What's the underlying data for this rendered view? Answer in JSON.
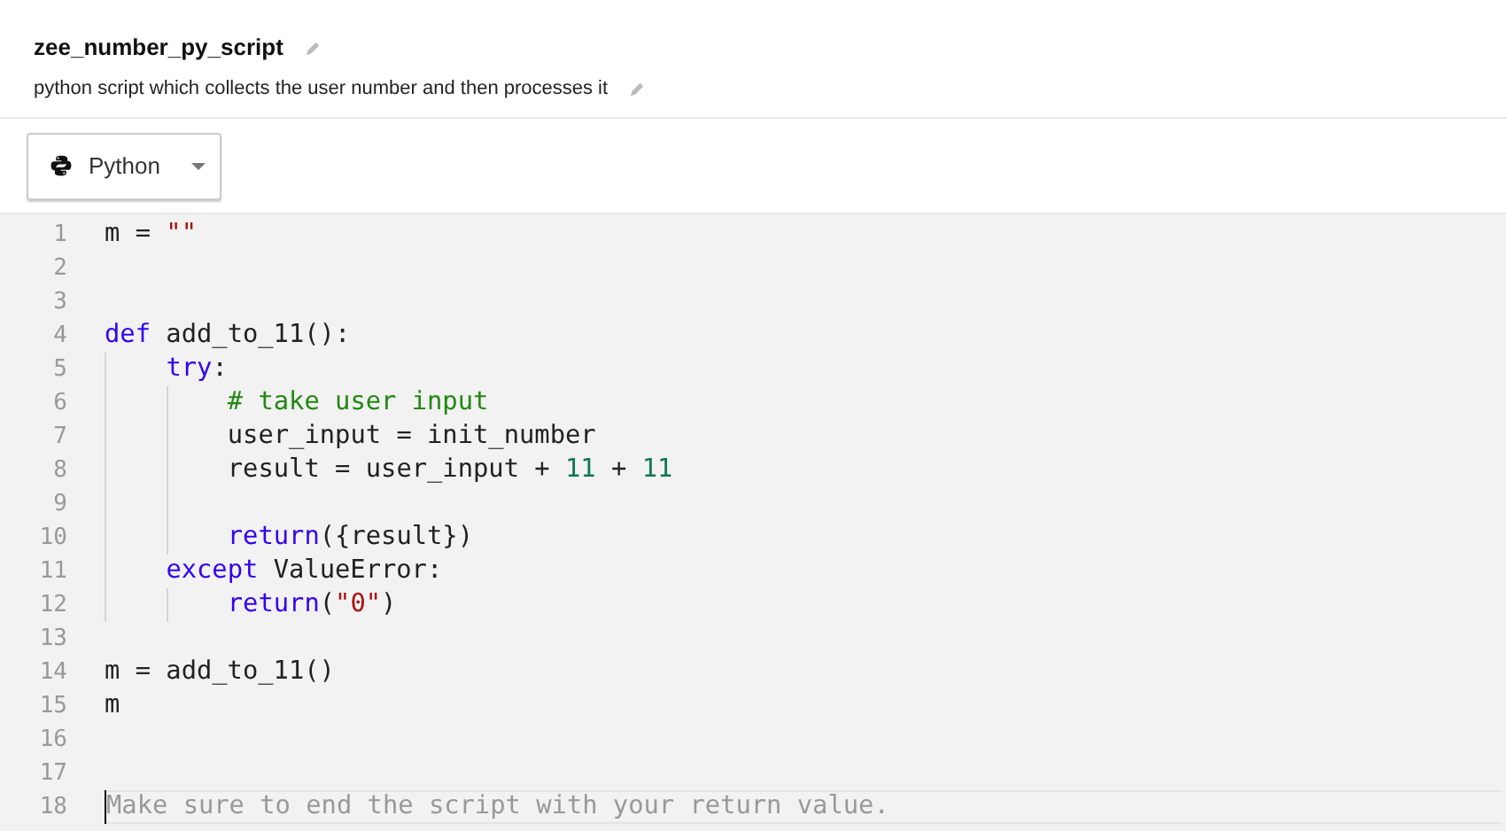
{
  "title": "zee_number_py_script",
  "description": "python script which collects the user number and then processes it",
  "language": {
    "label": "Python"
  },
  "editor": {
    "lines": [
      {
        "number": "1",
        "tokens": [
          {
            "kind": "plain",
            "text": "m = "
          },
          {
            "kind": "string",
            "text": "\"\""
          }
        ]
      },
      {
        "number": "2"
      },
      {
        "number": "3"
      },
      {
        "number": "4",
        "tokens": [
          {
            "kind": "keyword",
            "text": "def"
          },
          {
            "kind": "plain",
            "text": " add_to_11():"
          }
        ],
        "children": [
          {
            "number": "5",
            "tokens": [
              {
                "kind": "keyword",
                "text": "try"
              },
              {
                "kind": "plain",
                "text": ":"
              }
            ],
            "children": [
              {
                "number": "6",
                "tokens": [
                  {
                    "kind": "comment",
                    "text": "# take user input"
                  }
                ]
              },
              {
                "number": "7",
                "tokens": [
                  {
                    "kind": "plain",
                    "text": "user_input = init_number"
                  }
                ]
              },
              {
                "number": "8",
                "tokens": [
                  {
                    "kind": "plain",
                    "text": "result = user_input + "
                  },
                  {
                    "kind": "number",
                    "text": "11"
                  },
                  {
                    "kind": "plain",
                    "text": " + "
                  },
                  {
                    "kind": "number",
                    "text": "11"
                  }
                ]
              },
              {
                "number": "9"
              },
              {
                "number": "10",
                "tokens": [
                  {
                    "kind": "keyword",
                    "text": "return"
                  },
                  {
                    "kind": "plain",
                    "text": "({result})"
                  }
                ]
              }
            ]
          },
          {
            "number": "11",
            "tokens": [
              {
                "kind": "keyword",
                "text": "except"
              },
              {
                "kind": "plain",
                "text": " ValueError:"
              }
            ],
            "children": [
              {
                "number": "12",
                "tokens": [
                  {
                    "kind": "keyword",
                    "text": "return"
                  },
                  {
                    "kind": "plain",
                    "text": "("
                  },
                  {
                    "kind": "string",
                    "text": "\"0\""
                  },
                  {
                    "kind": "plain",
                    "text": ")"
                  }
                ]
              }
            ]
          }
        ]
      },
      {
        "number": "13"
      },
      {
        "number": "14",
        "tokens": [
          {
            "kind": "plain",
            "text": "m = add_to_11()"
          }
        ]
      },
      {
        "number": "15",
        "tokens": [
          {
            "kind": "plain",
            "text": "m"
          }
        ]
      },
      {
        "number": "16"
      },
      {
        "number": "17"
      },
      {
        "number": "18",
        "placeholder": "Make sure to end the script with your return value."
      }
    ]
  }
}
